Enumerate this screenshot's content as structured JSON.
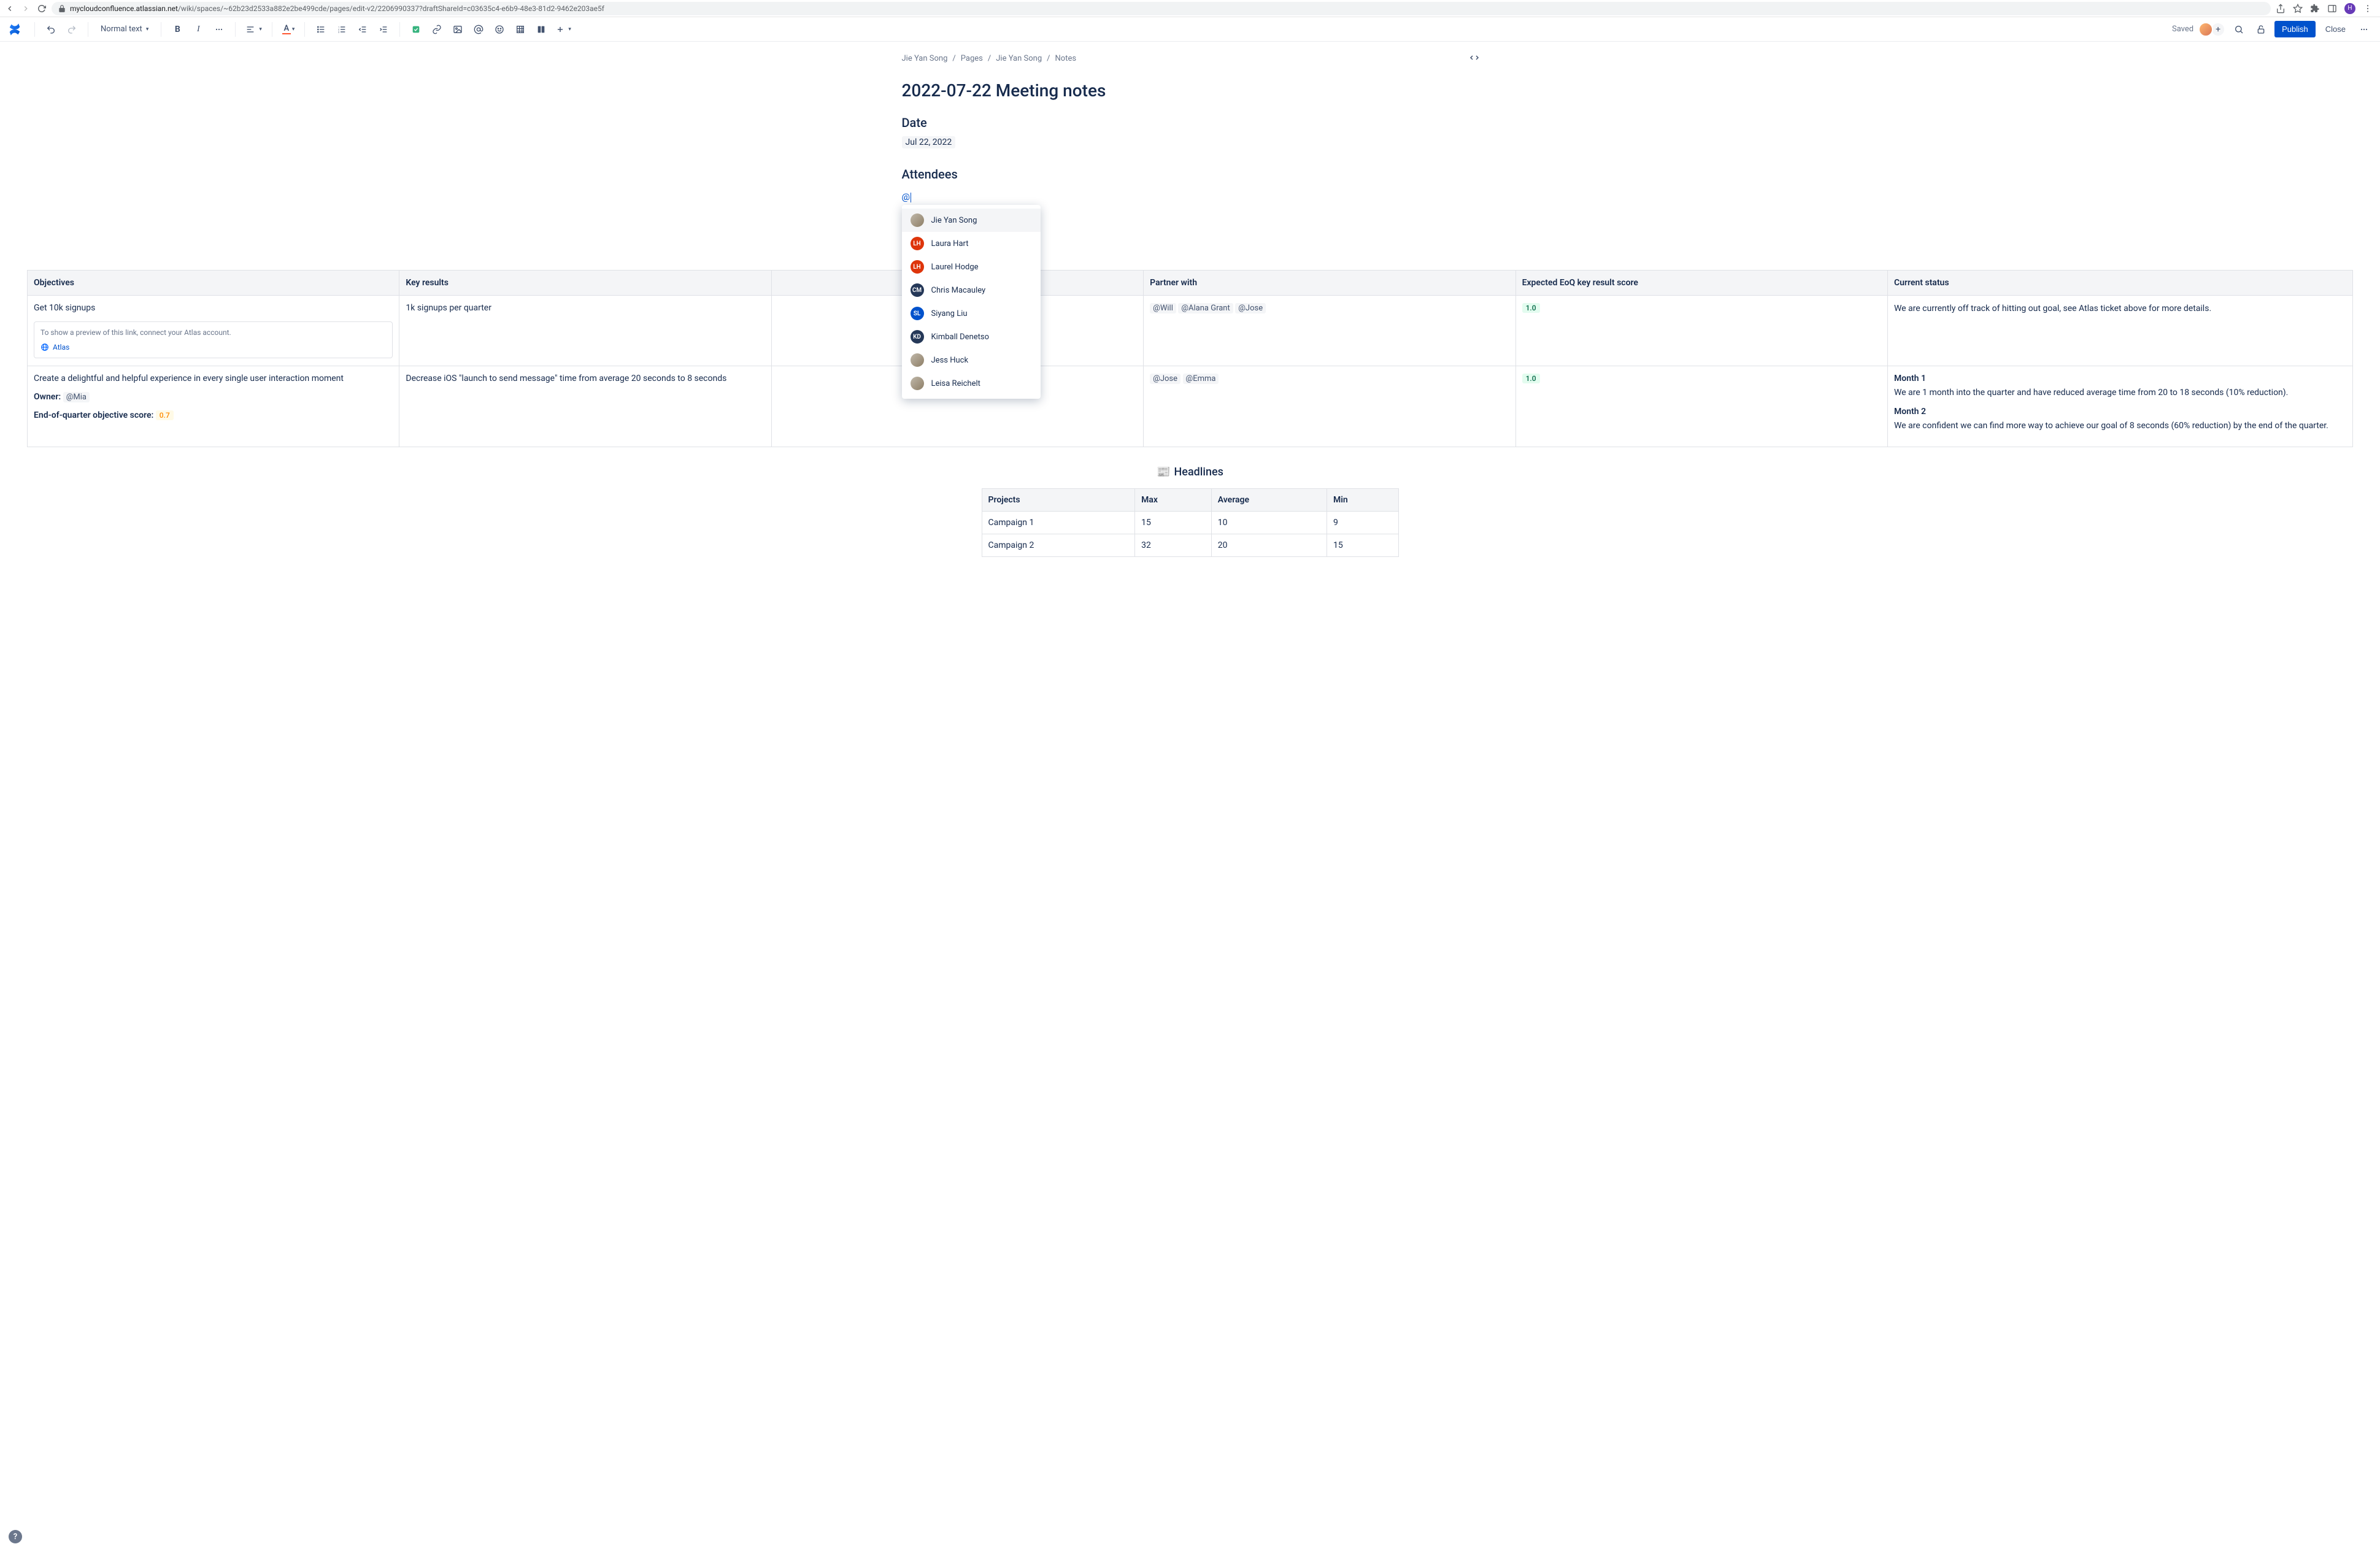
{
  "browser": {
    "url_host": "mycloudconfluence.atlassian.net",
    "url_path": "/wiki/spaces/~62b23d2533a882e2be499cde/pages/edit-v2/2206990337?draftShareId=c03635c4-e6b9-48e3-81d2-9462e203ae5f",
    "profile_initial": "H"
  },
  "toolbar": {
    "text_style": "Normal text",
    "saved_label": "Saved",
    "publish_label": "Publish",
    "close_label": "Close"
  },
  "breadcrumbs": [
    "Jie Yan Song",
    "Pages",
    "Jie Yan Song",
    "Notes"
  ],
  "page": {
    "title": "2022-07-22 Meeting notes",
    "date_heading": "Date",
    "date_value": "Jul 22, 2022",
    "attendees_heading": "Attendees",
    "mention_prefix": "@"
  },
  "mention_popup": {
    "items": [
      {
        "name": "Jie Yan Song",
        "initials": "",
        "color": "img",
        "selected": true
      },
      {
        "name": "Laura Hart",
        "initials": "LH",
        "color": "#de350b"
      },
      {
        "name": "Laurel Hodge",
        "initials": "LH",
        "color": "#de350b"
      },
      {
        "name": "Chris Macauley",
        "initials": "CM",
        "color": "#253858"
      },
      {
        "name": "Siyang Liu",
        "initials": "SL",
        "color": "#0052cc"
      },
      {
        "name": "Kimball Denetso",
        "initials": "KD",
        "color": "#253858"
      },
      {
        "name": "Jess Huck",
        "initials": "",
        "color": "img"
      },
      {
        "name": "Leisa Reichelt",
        "initials": "",
        "color": "img"
      }
    ]
  },
  "big_table": {
    "headers": [
      "Objectives",
      "Key results",
      "",
      "Partner with",
      "Expected EoQ key result score",
      "Current status"
    ],
    "row1": {
      "objective": "Get 10k signups",
      "atlas_hint": "To show a preview of this link, connect your Atlas account.",
      "atlas_label": "Atlas",
      "key_result": "1k signups per quarter",
      "partners": [
        "@Will",
        "@Alana Grant",
        "@Jose"
      ],
      "score": "1.0",
      "status": "We are currently off track of hitting out goal, see Atlas ticket above for more details."
    },
    "row2": {
      "objective": "Create a delightful and helpful experience in every single user interaction moment",
      "owner_label": "Owner:",
      "owner": "@Mia",
      "eoq_label": "End-of-quarter objective score:",
      "eoq_score": "0.7",
      "key_result": "Decrease iOS \"launch to send message\" time from average 20 seconds to 8 seconds",
      "partners": [
        "@Jose",
        "@Emma"
      ],
      "score": "1.0",
      "status_m1_h": "Month 1",
      "status_m1": "We are 1 month into the quarter and have reduced average time from 20 to 18 seconds (10% reduction).",
      "status_m2_h": "Month 2",
      "status_m2": "We are confident we can find more way to achieve our goal of 8 seconds (60% reduction) by the end of the quarter."
    }
  },
  "headlines": {
    "emoji": "📰",
    "title": "Headlines",
    "headers": [
      "Projects",
      "Max",
      "Average",
      "Min"
    ],
    "rows": [
      [
        "Campaign 1",
        "15",
        "10",
        "9"
      ],
      [
        "Campaign 2",
        "32",
        "20",
        "15"
      ]
    ]
  },
  "chart_data": {
    "type": "table",
    "title": "Headlines",
    "columns": [
      "Projects",
      "Max",
      "Average",
      "Min"
    ],
    "rows": [
      {
        "Projects": "Campaign 1",
        "Max": 15,
        "Average": 10,
        "Min": 9
      },
      {
        "Projects": "Campaign 2",
        "Max": 32,
        "Average": 20,
        "Min": 15
      }
    ]
  },
  "help": "?"
}
